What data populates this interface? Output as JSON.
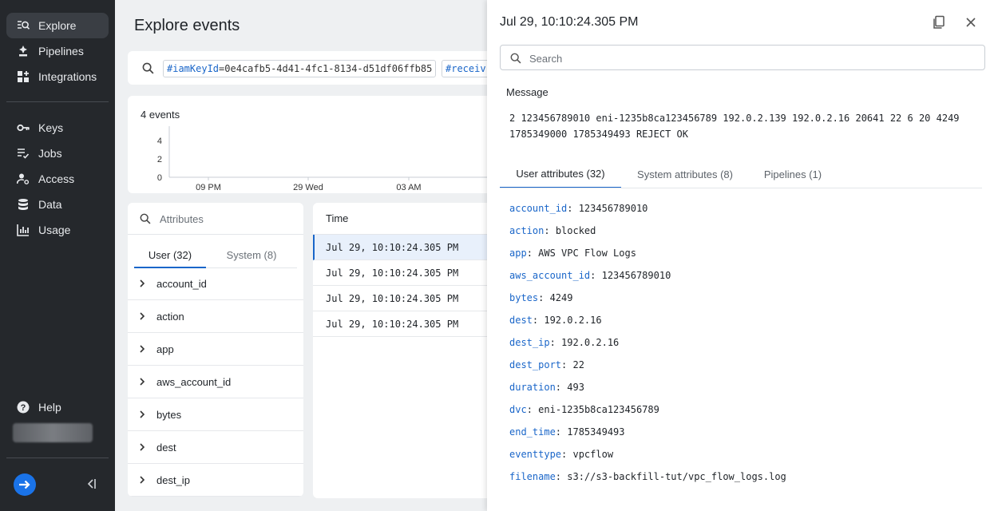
{
  "sidebar": {
    "items": [
      {
        "label": "Explore",
        "icon": "explore-search-icon"
      },
      {
        "label": "Pipelines",
        "icon": "pipelines-icon"
      },
      {
        "label": "Integrations",
        "icon": "integrations-icon"
      },
      {
        "label": "Keys",
        "icon": "key-icon"
      },
      {
        "label": "Jobs",
        "icon": "jobs-icon"
      },
      {
        "label": "Access",
        "icon": "access-icon"
      },
      {
        "label": "Data",
        "icon": "database-icon"
      },
      {
        "label": "Usage",
        "icon": "bar-chart-icon"
      }
    ],
    "help_label": "Help"
  },
  "main": {
    "title": "Explore events",
    "query_chips": [
      {
        "key": "#iamKeyId",
        "value": "0e4cafb5-4d41-4fc1-8134-d51df06ffb85"
      },
      {
        "key": "#receiv",
        "value": ""
      }
    ],
    "event_count": "4 events",
    "chart": {
      "y_ticks": [
        "4",
        "2",
        "0"
      ],
      "x_ticks": [
        "09 PM",
        "29 Wed",
        "03 AM"
      ]
    },
    "attributes": {
      "search_placeholder": "Attributes",
      "tab_user": "User (32)",
      "tab_system": "System (8)",
      "items": [
        "account_id",
        "action",
        "app",
        "aws_account_id",
        "bytes",
        "dest",
        "dest_ip"
      ]
    },
    "events_list": {
      "header": "Time",
      "rows": [
        "Jul 29, 10:10:24.305 PM",
        "Jul 29, 10:10:24.305 PM",
        "Jul 29, 10:10:24.305 PM",
        "Jul 29, 10:10:24.305 PM"
      ]
    }
  },
  "panel": {
    "title": "Jul 29, 10:10:24.305 PM",
    "search_placeholder": "Search",
    "message_label": "Message",
    "message_line1": "2 123456789010 eni-1235b8ca123456789 192.0.2.139 192.0.2.16 20641 22 6 20 4249",
    "message_line2": "1785349000 1785349493 REJECT OK",
    "tabs": [
      "User attributes (32)",
      "System attributes (8)",
      "Pipelines (1)"
    ],
    "attributes": [
      {
        "key": "account_id",
        "value": "123456789010"
      },
      {
        "key": "action",
        "value": "blocked"
      },
      {
        "key": "app",
        "value": "AWS VPC Flow Logs"
      },
      {
        "key": "aws_account_id",
        "value": "123456789010"
      },
      {
        "key": "bytes",
        "value": "4249"
      },
      {
        "key": "dest",
        "value": "192.0.2.16"
      },
      {
        "key": "dest_ip",
        "value": "192.0.2.16"
      },
      {
        "key": "dest_port",
        "value": "22"
      },
      {
        "key": "duration",
        "value": "493"
      },
      {
        "key": "dvc",
        "value": "eni-1235b8ca123456789"
      },
      {
        "key": "end_time",
        "value": "1785349493"
      },
      {
        "key": "eventtype",
        "value": "vpcflow"
      },
      {
        "key": "filename",
        "value": "s3://s3-backfill-tut/vpc_flow_logs.log"
      }
    ]
  },
  "colors": {
    "accent": "#1a66c9",
    "sidebar_bg": "#25282c",
    "brand": "#1a73e8"
  }
}
